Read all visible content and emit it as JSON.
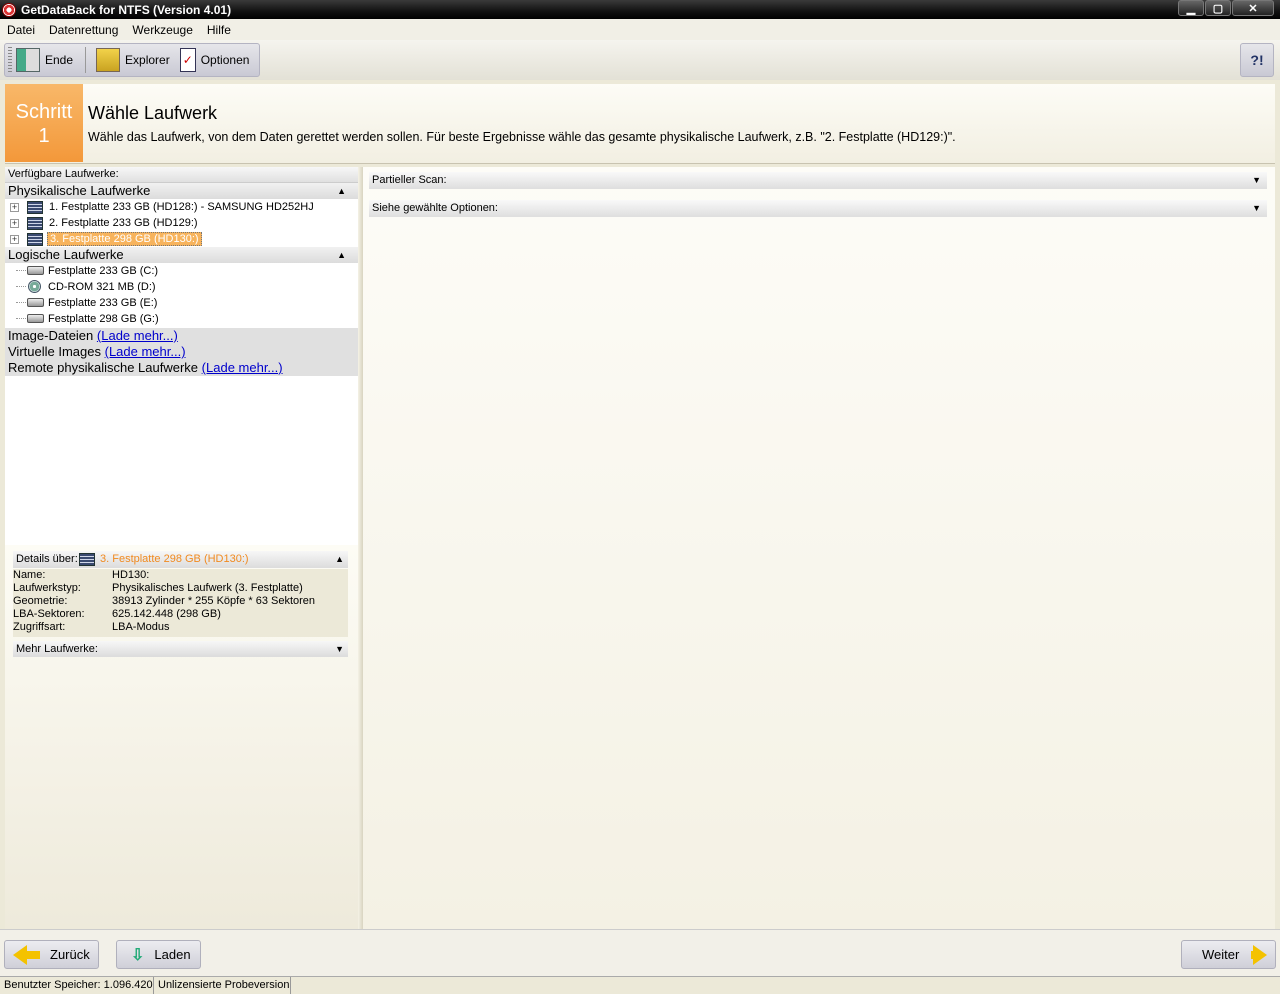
{
  "window": {
    "title": "GetDataBack for NTFS (Version 4.01)"
  },
  "menu": [
    "Datei",
    "Datenrettung",
    "Werkzeuge",
    "Hilfe"
  ],
  "toolbar": {
    "exit_label": "Ende",
    "explorer_label": "Explorer",
    "options_label": "Optionen",
    "help_symbol": "?!"
  },
  "header": {
    "step_word": "Schritt",
    "step_number": "1",
    "title": "Wähle Laufwerk",
    "description": "Wähle das Laufwerk, von dem Daten gerettet werden sollen. Für beste Ergebnisse wähle das gesamte physikalische Laufwerk, z.B. \"2. Festplatte (HD129:)\"."
  },
  "drives": {
    "label": "Verfügbare Laufwerke:",
    "physical_header": "Physikalische Laufwerke",
    "physical": [
      {
        "label": "1. Festplatte 233 GB (HD128:) - SAMSUNG HD252HJ"
      },
      {
        "label": "2. Festplatte 233 GB (HD129:)"
      },
      {
        "label": "3. Festplatte 298 GB (HD130:)"
      }
    ],
    "logical_header": "Logische Laufwerke",
    "logical": [
      {
        "label": "Festplatte 233 GB (C:)",
        "icon": "hard-drive-icon"
      },
      {
        "label": "CD-ROM 321 MB (D:)",
        "icon": "cdrom-icon"
      },
      {
        "label": "Festplatte 233 GB (E:)",
        "icon": "hard-drive-icon"
      },
      {
        "label": "Festplatte 298 GB (G:)",
        "icon": "hard-drive-icon"
      }
    ],
    "image_files": "Image-Dateien",
    "virtual_images": "Virtuelle Images",
    "remote_physical": "Remote physikalische Laufwerke",
    "load_more": "(Lade mehr...)"
  },
  "details": {
    "label": "Details über:",
    "selected": "3. Festplatte 298 GB (HD130:)",
    "rows": [
      {
        "key": "Name:",
        "value": "HD130:"
      },
      {
        "key": "Laufwerkstyp:",
        "value": "Physikalisches Laufwerk (3. Festplatte)"
      },
      {
        "key": "Geometrie:",
        "value": "38913 Zylinder * 255 Köpfe * 63 Sektoren"
      },
      {
        "key": "LBA-Sektoren:",
        "value": "625.142.448 (298 GB)"
      },
      {
        "key": "Zugriffsart:",
        "value": "LBA-Modus"
      }
    ],
    "more_drives": "Mehr Laufwerke:"
  },
  "right": {
    "partial_scan": "Partieller Scan:",
    "options": "Siehe gewählte Optionen:"
  },
  "buttons": {
    "back": "Zurück",
    "load": "Laden",
    "next": "Weiter"
  },
  "status": {
    "memory": "Benutzter Speicher: 1.096.420",
    "license": "Unlizensierte Probeversion"
  },
  "colors": {
    "accent": "#f3983a",
    "link": "#0000cc"
  }
}
